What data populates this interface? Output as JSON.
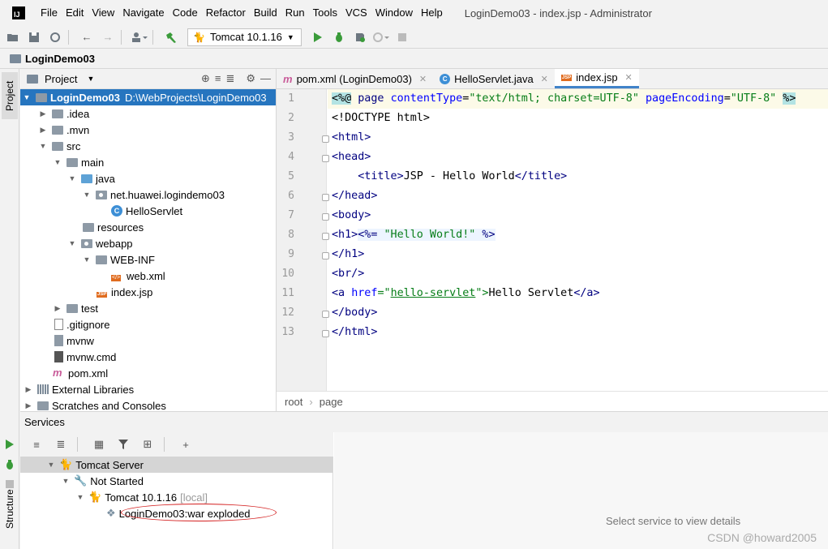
{
  "menubar": {
    "items": [
      "File",
      "Edit",
      "View",
      "Navigate",
      "Code",
      "Refactor",
      "Build",
      "Run",
      "Tools",
      "VCS",
      "Window",
      "Help"
    ],
    "window_title": "LoginDemo03 - index.jsp - Administrator"
  },
  "toolbar": {
    "run_config": "Tomcat 10.1.16"
  },
  "navbar": {
    "project": "LoginDemo03"
  },
  "stripe": {
    "project_tab": "Project",
    "structure_tab": "Structure"
  },
  "project_panel": {
    "title": "Project",
    "root_label": "LoginDemo03",
    "root_path": "D:\\WebProjects\\LoginDemo03",
    "rows": {
      "idea": ".idea",
      "mvn": ".mvn",
      "src": "src",
      "main": "main",
      "java": "java",
      "pkg": "net.huawei.logindemo03",
      "servlet": "HelloServlet",
      "resources": "resources",
      "webapp": "webapp",
      "webinf": "WEB-INF",
      "webxml": "web.xml",
      "indexjsp": "index.jsp",
      "test": "test",
      "gitignore": ".gitignore",
      "mvnw": "mvnw",
      "mvnwcmd": "mvnw.cmd",
      "pom": "pom.xml",
      "extlibs": "External Libraries",
      "scratches": "Scratches and Consoles"
    }
  },
  "editor": {
    "tabs": [
      "pom.xml (LoginDemo03)",
      "HelloServlet.java",
      "index.jsp"
    ],
    "line_numbers": [
      "1",
      "2",
      "3",
      "4",
      "5",
      "6",
      "7",
      "8",
      "9",
      "10",
      "11",
      "12",
      "13"
    ],
    "code": {
      "l1_a": "<%@",
      "l1_b": " page ",
      "l1_c": "contentType",
      "l1_d": "=",
      "l1_e": "\"text/html; charset=UTF-8\"",
      "l1_f": " pageEncoding",
      "l1_g": "=",
      "l1_h": "\"UTF-8\"",
      "l1_i": " ",
      "l1_j": "%>",
      "l2": "<!DOCTYPE html>",
      "l3": "<html>",
      "l4": "<head>",
      "l5_a": "    <title>",
      "l5_b": "JSP - Hello World",
      "l5_c": "</title>",
      "l6": "</head>",
      "l7": "<body>",
      "l8_a": "<h1>",
      "l8_b": "<%= ",
      "l8_c": "\"Hello World!\"",
      "l8_d": " %>",
      "l9": "</h1>",
      "l10": "<br/>",
      "l11_a": "<a ",
      "l11_b": "href",
      "l11_c": "=\"",
      "l11_d": "hello-servlet",
      "l11_e": "\">",
      "l11_f": "Hello Servlet",
      "l11_g": "</a>",
      "l12": "</body>",
      "l13": "</html>"
    },
    "breadcrumb": [
      "root",
      "page"
    ]
  },
  "services": {
    "title": "Services",
    "tree": {
      "server": "Tomcat Server",
      "status": "Not Started",
      "instance": "Tomcat 10.1.16",
      "instance_suffix": "[local]",
      "artifact": "LoginDemo03:war exploded"
    },
    "detail_placeholder": "Select service to view details"
  },
  "watermark": "CSDN @howard2005"
}
